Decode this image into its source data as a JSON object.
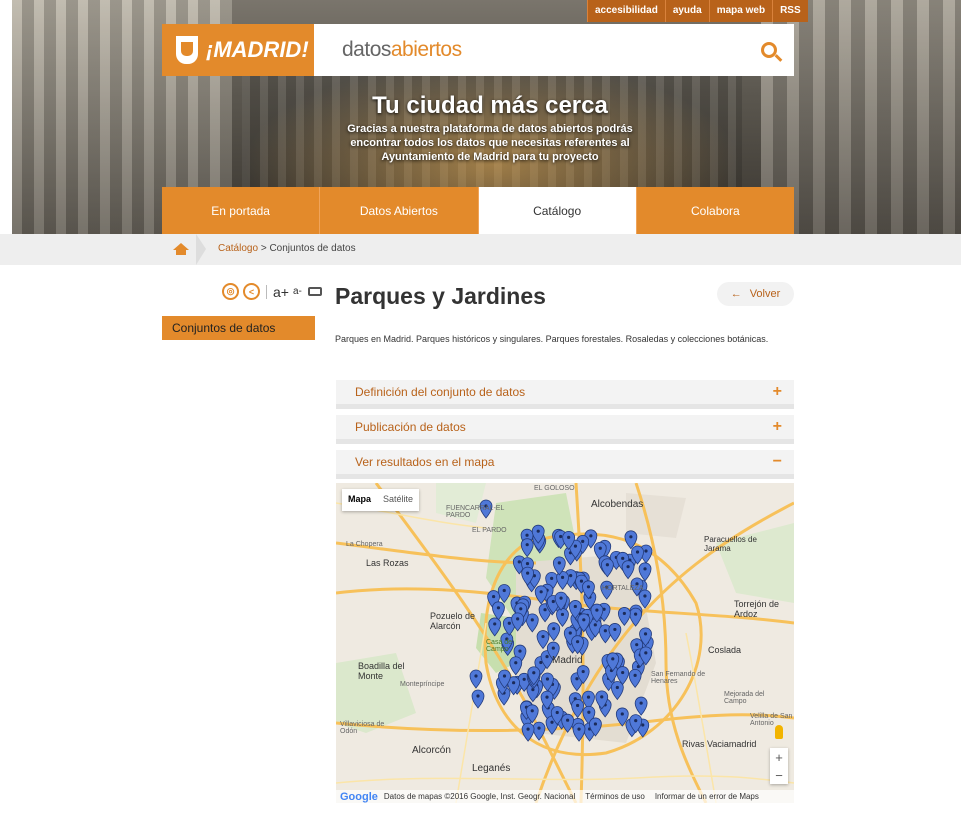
{
  "top_links": [
    "accesibilidad",
    "ayuda",
    "mapa web",
    "RSS"
  ],
  "brand": {
    "logo_text": "¡MADRID!",
    "site_part1": "datos",
    "site_part2": "abiertos"
  },
  "tagline": {
    "title": "Tu ciudad más cerca",
    "text": "Gracias a nuestra plataforma de datos abiertos podrás encontrar todos los datos que necesitas referentes al Ayuntamiento de Madrid para tu proyecto"
  },
  "nav": [
    {
      "label": "En portada"
    },
    {
      "label": "Datos Abiertos"
    },
    {
      "label": "Catálogo"
    },
    {
      "label": "Colabora"
    }
  ],
  "breadcrumb": {
    "link": "Catálogo",
    "sep": ">",
    "current": "Conjuntos de datos"
  },
  "sidebar": {
    "tool_a_plus": "a+",
    "tool_a_minus": "a-",
    "item": "Conjuntos de datos"
  },
  "page": {
    "title": "Parques y Jardines",
    "back_label": "Volver",
    "back_arrow": "←",
    "description": "Parques en Madrid. Parques históricos y singulares. Parques forestales. Rosaledas y colecciones botánicas."
  },
  "accordion": [
    {
      "label": "Definición del conjunto de datos",
      "sign": "+"
    },
    {
      "label": "Publicación de datos",
      "sign": "+"
    },
    {
      "label": "Ver resultados en el mapa",
      "sign": "−"
    }
  ],
  "map": {
    "type_map": "Mapa",
    "type_satellite": "Satélite",
    "zoom_in": "+",
    "zoom_out": "−",
    "google": "Google",
    "attribution": "Datos de mapas ©2016 Google, Inst. Geogr. Nacional",
    "terms": "Términos de uso",
    "report": "Informar de un error de Maps",
    "labels": {
      "alcobendas": "Alcobendas",
      "fuencarral": "FUENCARRAL-EL PARDO",
      "el_pardo": "EL PARDO",
      "el_goloso": "EL GOLOSO",
      "paracuellos": "Paracuellos de Jarama",
      "la_chopera": "La Chopera",
      "las_rozas": "Las Rozas",
      "pozuelo": "Pozuelo de Alarcón",
      "torrejon": "Torrejón de Ardoz",
      "casa_campo": "Casa de Campo",
      "coslada": "Coslada",
      "boadilla": "Boadilla del Monte",
      "montepríncipe": "Montepríncipe",
      "san_fernando": "San Fernando de Henares",
      "mejorada": "Mejorada del Campo",
      "villaviciosa": "Villaviciosa de Odón",
      "alcorcon": "Alcorcón",
      "rivas": "Rivas Vaciamadrid",
      "velilla": "Velilla de San Antonio",
      "leganes": "Leganés",
      "madrid": "Madrid",
      "hortaleza": "HORTALEZA"
    }
  }
}
